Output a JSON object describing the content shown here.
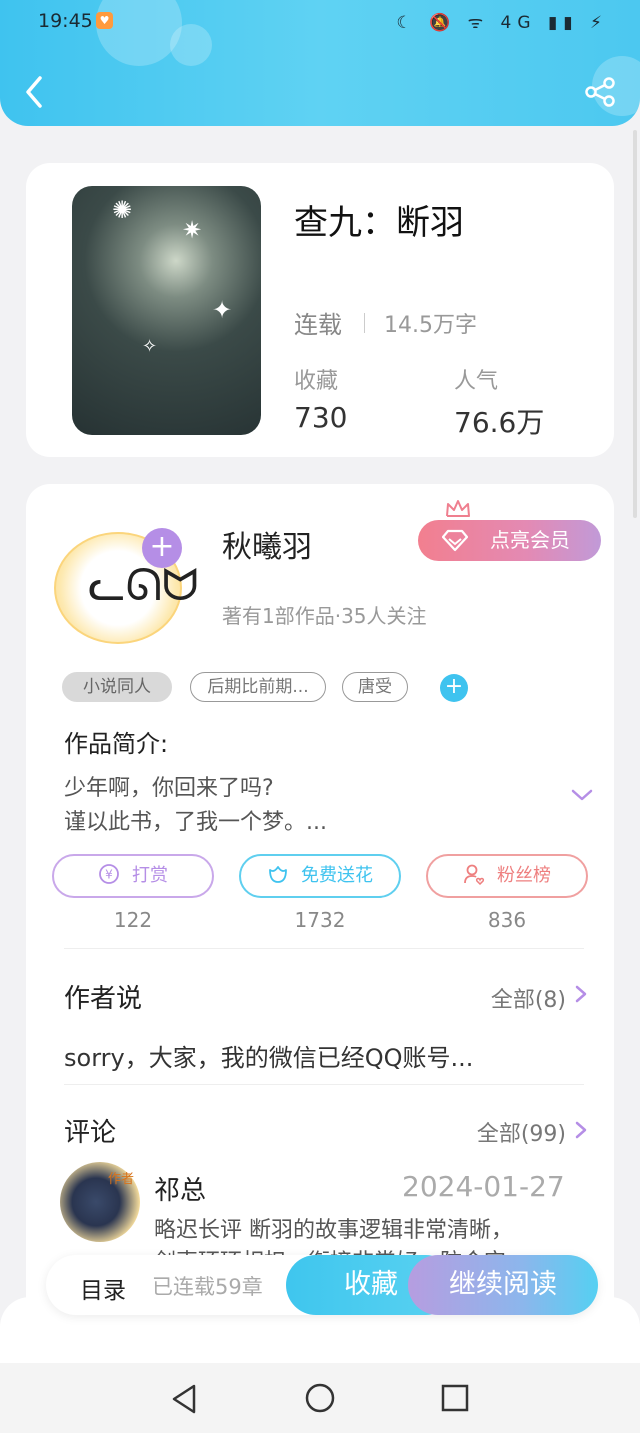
{
  "status_bar": {
    "time": "19:45",
    "icons": "☾ 🔕 ᯤ 4G ▮▮ ⚡"
  },
  "header": {
    "back_icon": "chevron-left-icon",
    "share_icon": "share-icon"
  },
  "book": {
    "title": "查九：断羽",
    "status": "连载",
    "word_count": "14.5万字",
    "favorites_label": "收藏",
    "favorites_value": "730",
    "popularity_label": "人气",
    "popularity_value": "76.6万"
  },
  "author": {
    "name": "秋曦羽",
    "meta": "著有1部作品·35人关注",
    "follow_symbol": "+",
    "vip_label": "点亮会员"
  },
  "tags": [
    {
      "label": "小说同人"
    },
    {
      "label": "后期比前期..."
    },
    {
      "label": "唐受"
    }
  ],
  "tag_add_symbol": "+",
  "intro": {
    "title": "作品简介:",
    "lines": [
      "少年啊，你回来了吗?",
      "谨以此书，了我一个梦。..."
    ]
  },
  "actions": [
    {
      "label": "打赏",
      "count": "122",
      "color": "#b58ee6"
    },
    {
      "label": "免费送花",
      "count": "1732",
      "color": "#3fc3ef"
    },
    {
      "label": "粉丝榜",
      "count": "836",
      "color": "#ee7f7f"
    }
  ],
  "author_says": {
    "title": "作者说",
    "more": "全部(8)",
    "text": "sorry，大家，我的微信已经QQ账号..."
  },
  "comments": {
    "title": "评论",
    "more": "全部(99)",
    "items": [
      {
        "badge": "作者",
        "name": "祁总",
        "date": "2024-01-27",
        "text": "略迟长评    断羽的故事逻辑非常清晰，",
        "text2": "剑声环环相扣，衔接非常好，防合守"
      }
    ]
  },
  "bottom_bar": {
    "toc": "目录",
    "chapters": "已连载59章",
    "collect": "收藏",
    "continue": "继续阅读"
  },
  "colors": {
    "accent_blue": "#3fc3ef",
    "accent_purple": "#b58ee6",
    "accent_red": "#ee7f7f"
  }
}
